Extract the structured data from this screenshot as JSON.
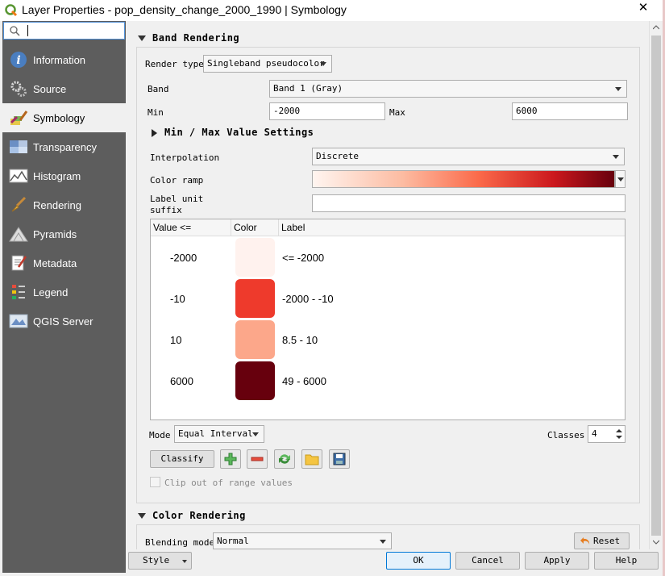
{
  "window": {
    "title": "Layer Properties - pop_density_change_2000_1990 | Symbology",
    "close_glyph": "✕"
  },
  "search": {
    "value": "",
    "placeholder": ""
  },
  "sidebar": {
    "items": [
      {
        "label": "Information",
        "icon": "information-icon"
      },
      {
        "label": "Source",
        "icon": "source-gears-icon"
      },
      {
        "label": "Symbology",
        "icon": "symbology-brush-icon",
        "active": true
      },
      {
        "label": "Transparency",
        "icon": "transparency-icon"
      },
      {
        "label": "Histogram",
        "icon": "histogram-icon"
      },
      {
        "label": "Rendering",
        "icon": "rendering-brush-icon"
      },
      {
        "label": "Pyramids",
        "icon": "pyramids-icon"
      },
      {
        "label": "Metadata",
        "icon": "metadata-icon"
      },
      {
        "label": "Legend",
        "icon": "legend-icon"
      },
      {
        "label": "QGIS Server",
        "icon": "qgis-server-icon"
      }
    ]
  },
  "band_rendering": {
    "header": "Band Rendering",
    "render_type_label": "Render type",
    "render_type_value": "Singleband pseudocolor",
    "band_label": "Band",
    "band_value": "Band 1 (Gray)",
    "min_label": "Min",
    "min_value": "-2000",
    "max_label": "Max",
    "max_value": "6000",
    "minmax_header": "Min / Max Value Settings",
    "interpolation_label": "Interpolation",
    "interpolation_value": "Discrete",
    "color_ramp_label": "Color ramp",
    "label_unit_label_1": "Label unit",
    "label_unit_label_2": "suffix",
    "label_unit_value": "",
    "table": {
      "headers": [
        "Value <=",
        "Color",
        "Label"
      ],
      "rows": [
        {
          "value": "-2000",
          "color": "#fff2ee",
          "label": "<= -2000"
        },
        {
          "value": "-10",
          "color": "#ee3a2c",
          "label": "-2000 - -10"
        },
        {
          "value": "10",
          "color": "#fca78a",
          "label": "8.5 - 10"
        },
        {
          "value": "6000",
          "color": "#67000d",
          "label": "49 - 6000"
        }
      ]
    },
    "mode_label": "Mode",
    "mode_value": "Equal Interval",
    "classes_label": "Classes",
    "classes_value": "4",
    "classify_label": "Classify",
    "clip_label": "Clip out of range values"
  },
  "color_rendering": {
    "header": "Color Rendering",
    "blending_label": "Blending mode",
    "blending_value": "Normal",
    "reset_label": "Reset"
  },
  "footer": {
    "style_label": "Style",
    "ok_label": "OK",
    "cancel_label": "Cancel",
    "apply_label": "Apply",
    "help_label": "Help"
  },
  "colors": {
    "ramp_start": "#fff5f0",
    "ramp_end": "#67000d",
    "sidebar_bg": "#5d5d5d"
  }
}
